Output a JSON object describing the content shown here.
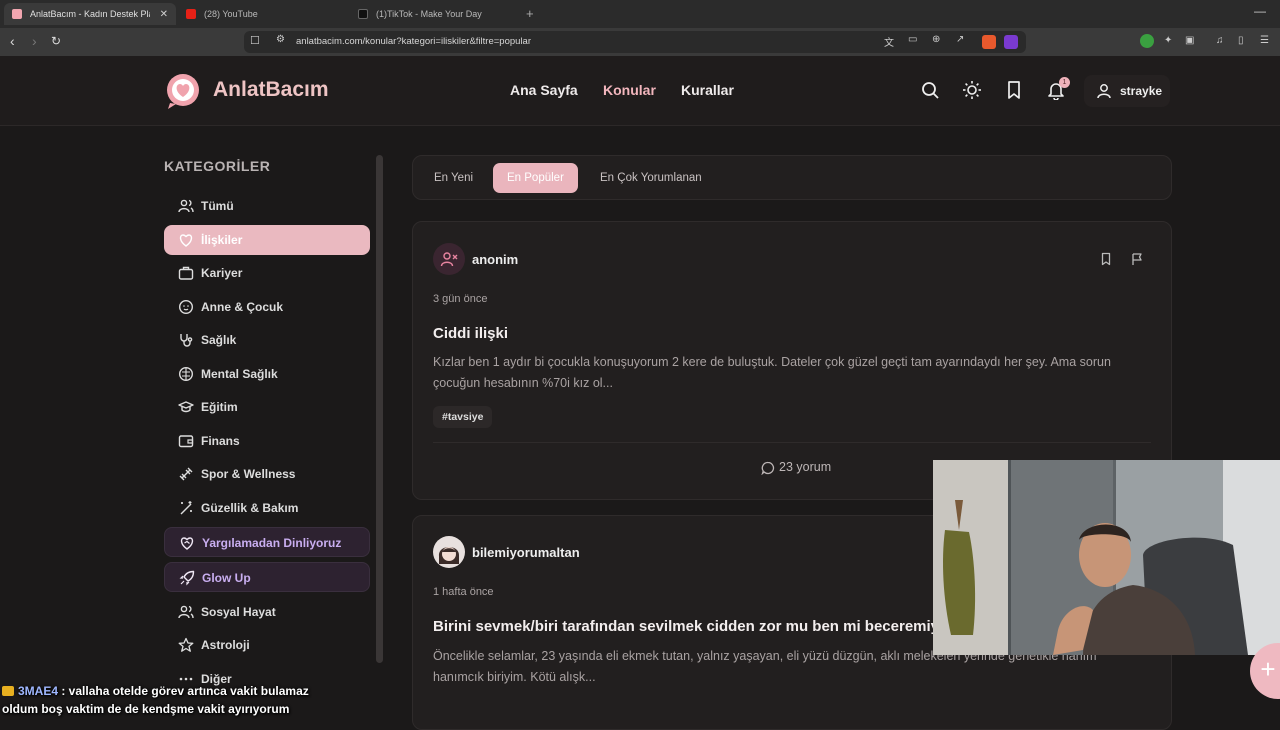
{
  "browser": {
    "tabs": [
      {
        "label": "AnlatBacım - Kadın Destek Platfo",
        "close": "✕"
      },
      {
        "label": "(28) YouTube"
      },
      {
        "label": "(1)TikTok - Make Your Day"
      }
    ],
    "url": "anlatbacim.com/konular?kategori=iliskiler&filtre=popular"
  },
  "site": {
    "logo_text": "AnlatBacım",
    "nav": [
      "Ana Sayfa",
      "Konular",
      "Kurallar"
    ],
    "notification_count": "1",
    "username": "strayke"
  },
  "sidebar": {
    "title": "KATEGORİLER",
    "items": [
      {
        "label": "Tümü",
        "icon": "users-icon"
      },
      {
        "label": "İlişkiler",
        "icon": "heart-icon"
      },
      {
        "label": "Kariyer",
        "icon": "briefcase-icon"
      },
      {
        "label": "Anne & Çocuk",
        "icon": "baby-icon"
      },
      {
        "label": "Sağlık",
        "icon": "stethoscope-icon"
      },
      {
        "label": "Mental Sağlık",
        "icon": "brain-icon"
      },
      {
        "label": "Eğitim",
        "icon": "graduation-cap-icon"
      },
      {
        "label": "Finans",
        "icon": "wallet-icon"
      },
      {
        "label": "Spor & Wellness",
        "icon": "dumbbell-icon"
      },
      {
        "label": "Güzellik & Bakım",
        "icon": "sparkles-icon"
      },
      {
        "label": "Yargılamadan Dinliyoruz",
        "icon": "heart-handshake-icon"
      },
      {
        "label": "Glow Up",
        "icon": "rocket-icon"
      },
      {
        "label": "Sosyal Hayat",
        "icon": "users-icon"
      },
      {
        "label": "Astroloji",
        "icon": "star-icon"
      },
      {
        "label": "Diğer",
        "icon": "more-icon"
      }
    ]
  },
  "filters": [
    "En Yeni",
    "En Popüler",
    "En Çok Yorumlanan"
  ],
  "posts": [
    {
      "author": "anonim",
      "time": "3 gün önce",
      "title": "Ciddi ilişki",
      "body": "Kızlar ben 1 aydır bi çocukla konuşuyorum 2 kere de buluştuk. Dateler çok güzel geçti tam ayarındaydı her şey. Ama sorun çocuğun hesabının %70i kız ol...",
      "tag": "#tavsiye",
      "comments": "23 yorum"
    },
    {
      "author": "bilemiyorumaltan",
      "time": "1 hafta önce",
      "title": "Birini sevmek/biri tarafından sevilmek cidden zor mu ben mi beceremiyorum",
      "body": "Öncelikle selamlar, 23 yaşında eli ekmek tutan, yalnız yaşayan, eli yüzü düzgün, aklı melekeleri yerinde genetikle hanım hanımcık biriyim. Kötü alışk..."
    }
  ],
  "chat": {
    "username": "3MAE4",
    "line1": " : vallaha otelde görev artınca vakit bulamaz",
    "line2": "oldum boş vaktim de de kendşme vakit ayırıyorum"
  },
  "colors": {
    "accent": "#eab5bd",
    "special": "#c9aef0",
    "bg": "#1b1919"
  }
}
